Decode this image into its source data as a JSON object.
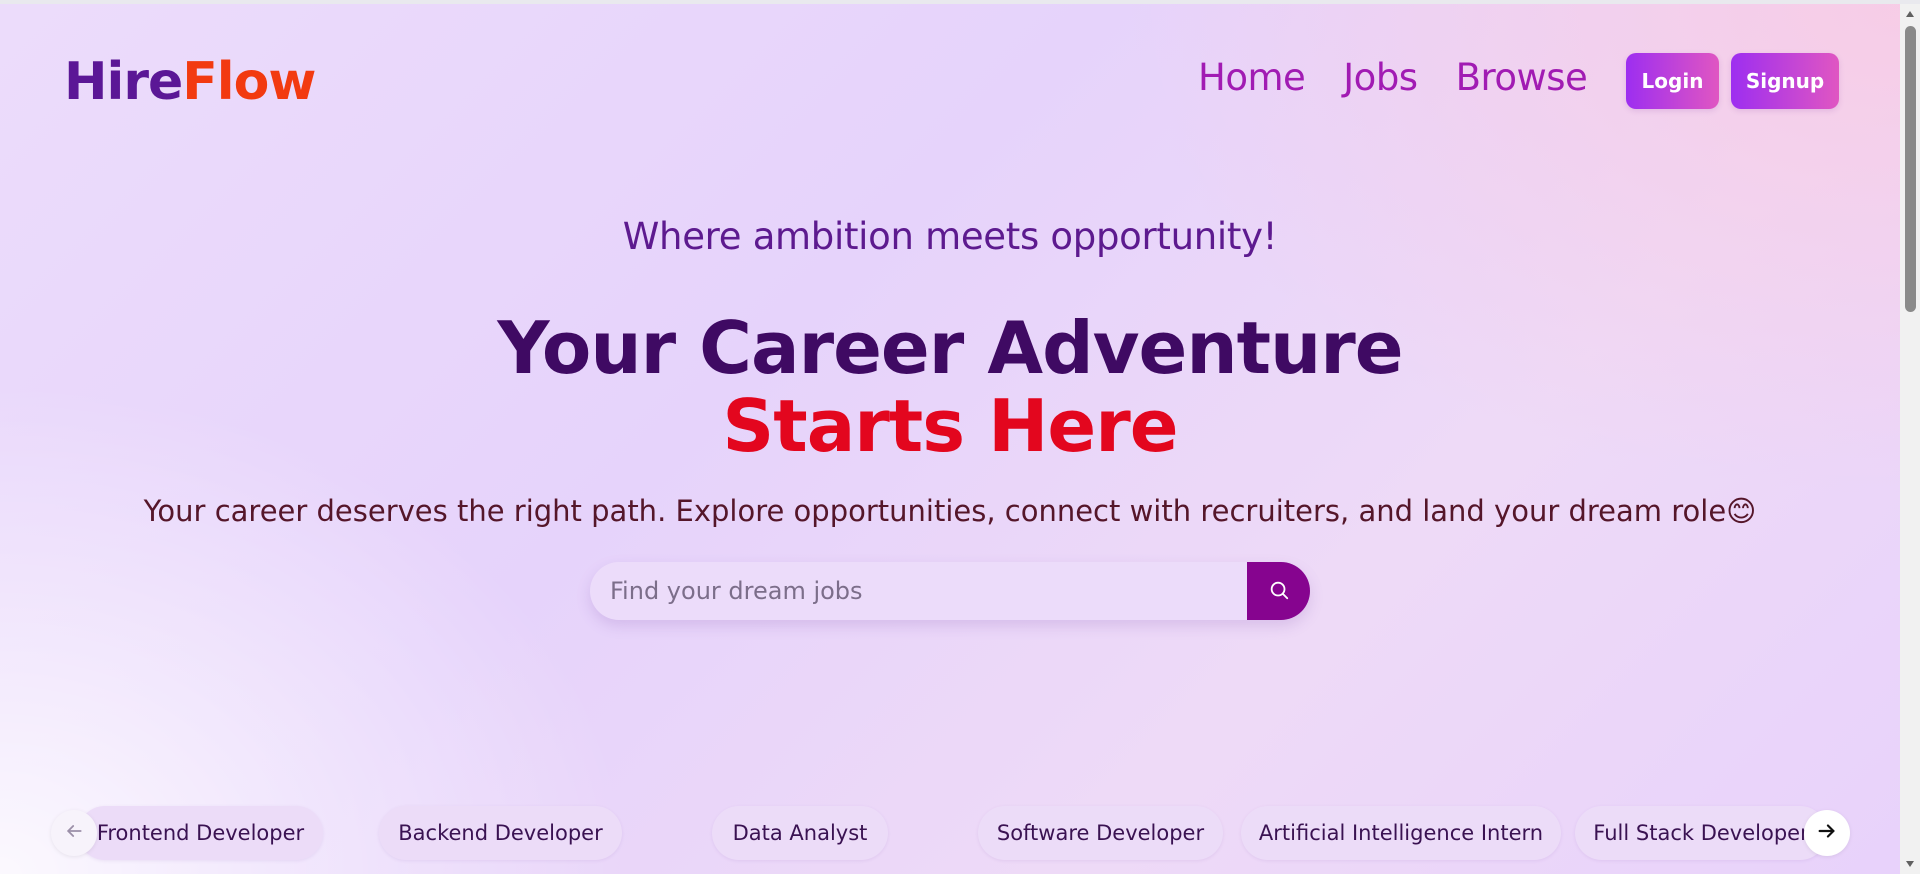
{
  "brand": {
    "part1": "Hire",
    "part2": "Flow"
  },
  "nav": {
    "items": [
      {
        "label": "Home"
      },
      {
        "label": "Jobs"
      },
      {
        "label": "Browse"
      }
    ]
  },
  "auth": {
    "login_label": "Login",
    "signup_label": "Signup"
  },
  "hero": {
    "tagline": "Where ambition meets opportunity!",
    "headline_line1": "Your Career Adventure",
    "headline_line2": "Starts Here",
    "description": "Your career deserves the right path. Explore opportunities, connect with recruiters, and land your dream role😊"
  },
  "search": {
    "placeholder": "Find your dream jobs",
    "value": "",
    "icon": "search-icon"
  },
  "categories": {
    "items": [
      {
        "label": "Frontend Developer"
      },
      {
        "label": "Backend Developer"
      },
      {
        "label": "Data Analyst"
      },
      {
        "label": "Software Developer"
      },
      {
        "label": "Artificial Intelligence Intern"
      },
      {
        "label": "Full Stack Developer"
      }
    ],
    "prev_icon": "arrow-left-icon",
    "next_icon": "arrow-right-icon"
  },
  "colors": {
    "brand_primary": "#5b1796",
    "brand_accent": "#f23a10",
    "nav_link": "#a11bb3",
    "headline": "#3f0a63",
    "headline_accent": "#e3061e",
    "search_button": "#86048f"
  }
}
